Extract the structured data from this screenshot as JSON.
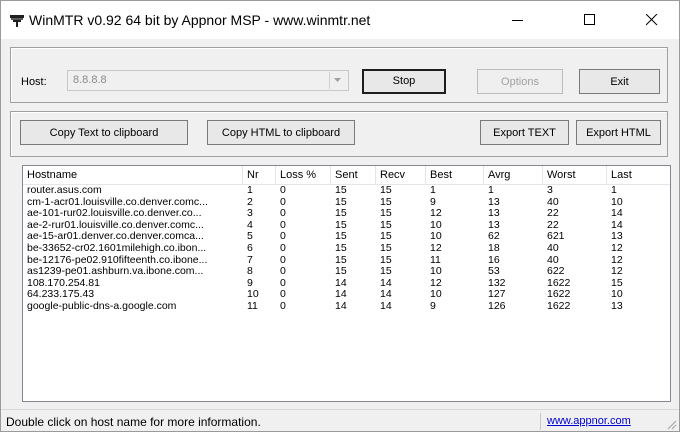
{
  "window": {
    "title": "WinMTR v0.92 64 bit by Appnor MSP - www.winmtr.net"
  },
  "host": {
    "label": "Host:",
    "value": "8.8.8.8"
  },
  "buttons": {
    "stop": "Stop",
    "options": "Options",
    "exit": "Exit",
    "copy_text": "Copy Text to clipboard",
    "copy_html": "Copy HTML to clipboard",
    "export_text": "Export TEXT",
    "export_html": "Export HTML"
  },
  "table": {
    "columns": [
      "Hostname",
      "Nr",
      "Loss %",
      "Sent",
      "Recv",
      "Best",
      "Avrg",
      "Worst",
      "Last"
    ],
    "rows": [
      [
        "router.asus.com",
        "1",
        "0",
        "15",
        "15",
        "1",
        "1",
        "3",
        "1"
      ],
      [
        "cm-1-acr01.louisville.co.denver.comc...",
        "2",
        "0",
        "15",
        "15",
        "9",
        "13",
        "40",
        "10"
      ],
      [
        "ae-101-rur02.louisville.co.denver.co...",
        "3",
        "0",
        "15",
        "15",
        "12",
        "13",
        "22",
        "14"
      ],
      [
        "ae-2-rur01.louisville.co.denver.comc...",
        "4",
        "0",
        "15",
        "15",
        "10",
        "13",
        "22",
        "14"
      ],
      [
        "ae-15-ar01.denver.co.denver.comca...",
        "5",
        "0",
        "15",
        "15",
        "10",
        "62",
        "621",
        "13"
      ],
      [
        "be-33652-cr02.1601milehigh.co.ibon...",
        "6",
        "0",
        "15",
        "15",
        "12",
        "18",
        "40",
        "12"
      ],
      [
        "be-12176-pe02.910fifteenth.co.ibone...",
        "7",
        "0",
        "15",
        "15",
        "11",
        "16",
        "40",
        "12"
      ],
      [
        "as1239-pe01.ashburn.va.ibone.com...",
        "8",
        "0",
        "15",
        "15",
        "10",
        "53",
        "622",
        "12"
      ],
      [
        "108.170.254.81",
        "9",
        "0",
        "14",
        "14",
        "12",
        "132",
        "1622",
        "15"
      ],
      [
        "64.233.175.43",
        "10",
        "0",
        "14",
        "14",
        "10",
        "127",
        "1622",
        "10"
      ],
      [
        "google-public-dns-a.google.com",
        "11",
        "0",
        "14",
        "14",
        "9",
        "126",
        "1622",
        "13"
      ]
    ]
  },
  "status": {
    "text": "Double click on host name for more information.",
    "link": "www.appnor.com"
  }
}
